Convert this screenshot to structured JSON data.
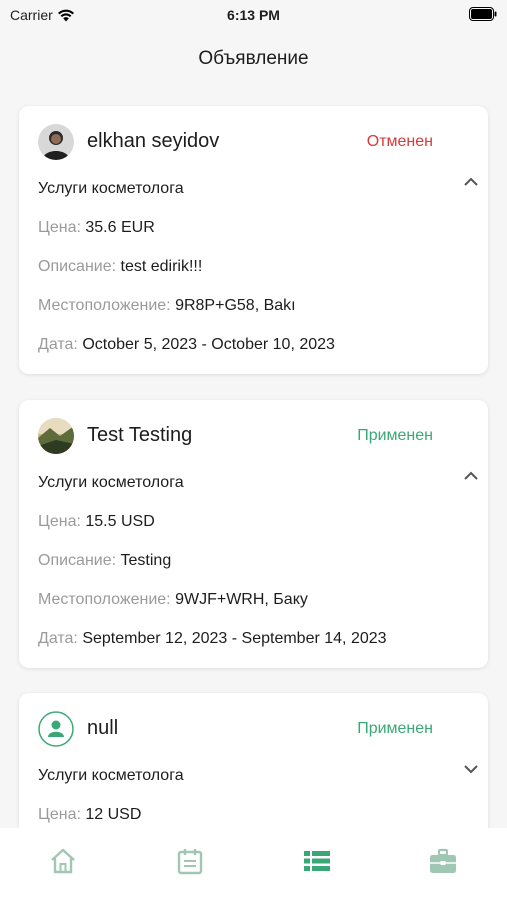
{
  "status_bar": {
    "carrier": "Carrier",
    "time": "6:13 PM"
  },
  "page": {
    "title": "Объявление"
  },
  "colors": {
    "accent": "#3aa876",
    "cancelled": "#d9383a",
    "inactive_tab": "#9fc7b3"
  },
  "cards": [
    {
      "name": "elkhan seyidov",
      "status": "Отменен",
      "status_kind": "cancelled",
      "service": "Услуги косметолога",
      "price_label": "Цена:",
      "price": "35.6 EUR",
      "desc_label": "Описание:",
      "desc": "test edirik!!!",
      "loc_label": "Местоположение:",
      "loc": "9R8P+G58, Bakı",
      "date_label": "Дата:",
      "date": "October 5, 2023 - October 10, 2023",
      "expanded": true,
      "avatar_icon": "photo-avatar"
    },
    {
      "name": "Test Testing",
      "status": "Применен",
      "status_kind": "applied",
      "service": "Услуги косметолога",
      "price_label": "Цена:",
      "price": "15.5 USD",
      "desc_label": "Описание:",
      "desc": "Testing",
      "loc_label": "Местоположение:",
      "loc": "9WJF+WRH, Баку",
      "date_label": "Дата:",
      "date": "September 12, 2023 - September 14, 2023",
      "expanded": true,
      "avatar_icon": "landscape-avatar"
    },
    {
      "name": "null",
      "status": "Применен",
      "status_kind": "applied",
      "service": "Услуги косметолога",
      "price_label": "Цена:",
      "price": "12 USD",
      "expanded": false,
      "avatar_icon": "person-placeholder-icon"
    }
  ],
  "tabbar": {
    "tabs": [
      {
        "icon": "home-icon",
        "active": false
      },
      {
        "icon": "calendar-icon",
        "active": false
      },
      {
        "icon": "list-icon",
        "active": true
      },
      {
        "icon": "briefcase-icon",
        "active": false
      }
    ]
  }
}
